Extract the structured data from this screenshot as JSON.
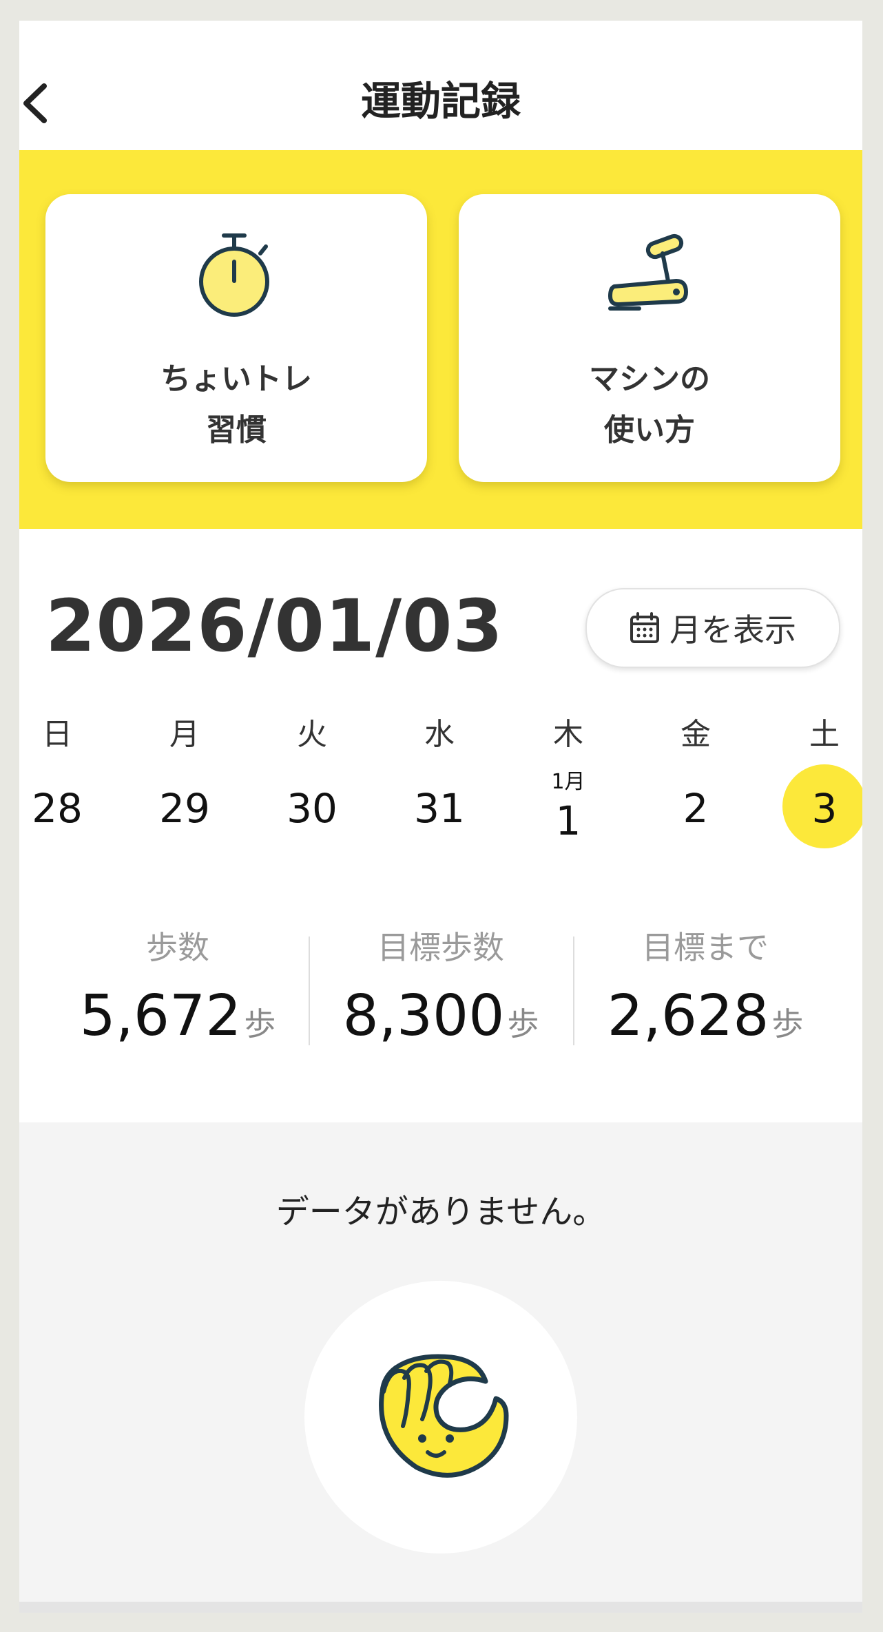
{
  "header": {
    "title": "運動記録",
    "back_icon": "chevron-left-icon"
  },
  "cards": [
    {
      "line1": "ちょいトレ",
      "line2": "習慣",
      "icon": "stopwatch-icon"
    },
    {
      "line1": "マシンの",
      "line2": "使い方",
      "icon": "treadmill-icon"
    }
  ],
  "date": {
    "heading": "2026/01/03",
    "month_button": "月を表示",
    "month_icon": "calendar-icon"
  },
  "week": {
    "days": [
      {
        "dow": "日",
        "date": "28"
      },
      {
        "dow": "月",
        "date": "29"
      },
      {
        "dow": "火",
        "date": "30"
      },
      {
        "dow": "水",
        "date": "31"
      },
      {
        "dow": "木",
        "date": "1",
        "month": "1月"
      },
      {
        "dow": "金",
        "date": "2"
      },
      {
        "dow": "土",
        "date": "3",
        "selected": true
      }
    ]
  },
  "stats": [
    {
      "label": "歩数",
      "value": "5,672",
      "unit": "歩"
    },
    {
      "label": "目標歩数",
      "value": "8,300",
      "unit": "歩"
    },
    {
      "label": "目標まで",
      "value": "2,628",
      "unit": "歩"
    }
  ],
  "empty": {
    "message": "データがありません。",
    "mascot_icon": "mascot-icon"
  },
  "colors": {
    "accent": "#fce83a",
    "background": "#ffffff",
    "empty_bg": "#f4f4f4"
  }
}
